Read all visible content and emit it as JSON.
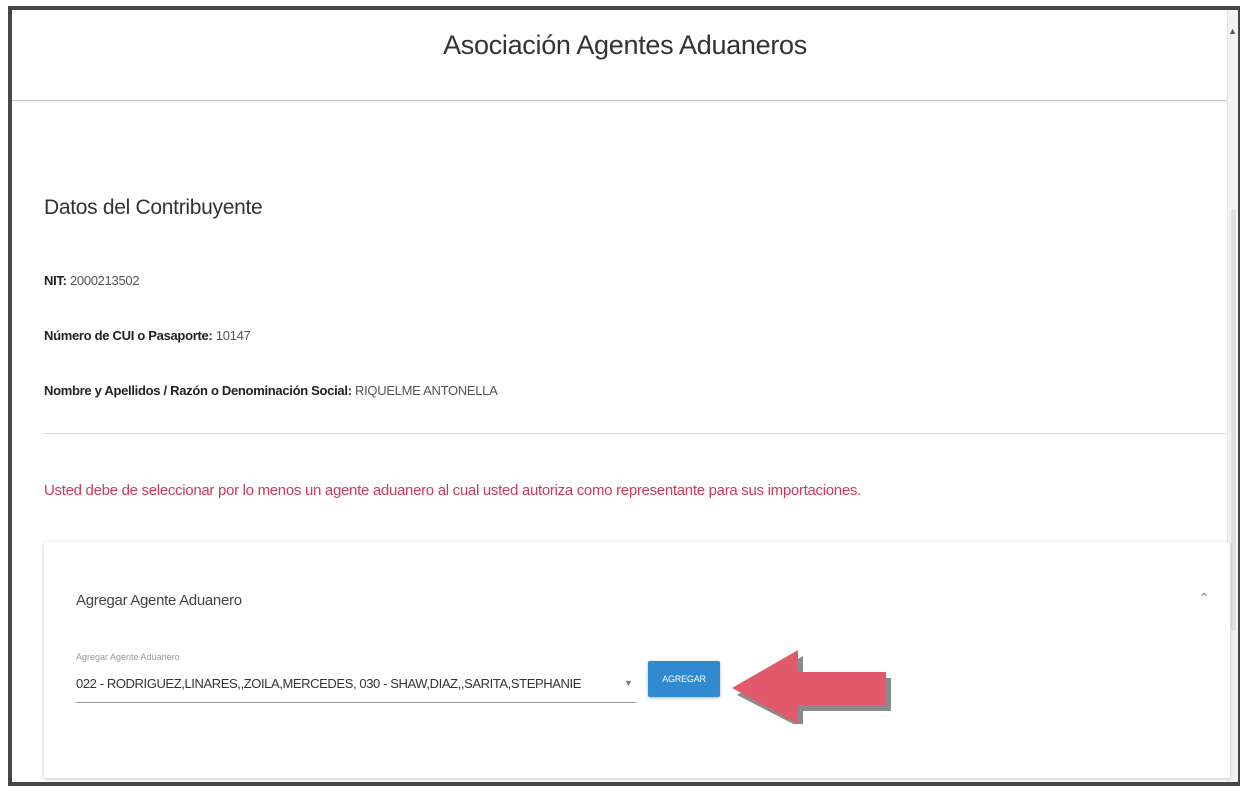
{
  "header": {
    "title": "Asociación Agentes Aduaneros"
  },
  "taxpayer": {
    "section_title": "Datos del Contribuyente",
    "nit_label": "NIT:",
    "nit_value": "2000213502",
    "cui_label": "Número de CUI o Pasaporte:",
    "cui_value": "10147",
    "name_label": "Nombre y Apellidos / Razón o Denominación Social:",
    "name_value": "RIQUELME ANTONELLA"
  },
  "warning": {
    "text": "Usted debe de seleccionar por lo menos un agente aduanero al cual usted autoriza como representante para sus importaciones.",
    "color": "#cc3a56"
  },
  "add_agent_panel": {
    "title": "Agregar Agente Aduanero",
    "expand_icon": "chevron-up-icon",
    "select": {
      "label": "Agregar Agente Aduanero",
      "value": "022 - RODRIGUEZ,LINARES,,ZOILA,MERCEDES, 030 - SHAW,DIAZ,,SARITA,STEPHANIE",
      "caret_icon": "caret-down-icon"
    },
    "button_label": "AGREGAR",
    "button_color": "#2f8ad0"
  },
  "annotation": {
    "icon": "arrow-left-icon",
    "color": "#e05a6c"
  }
}
